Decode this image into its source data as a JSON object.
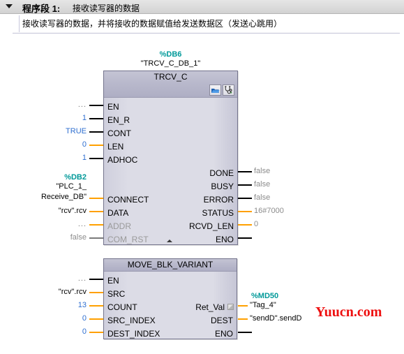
{
  "network": {
    "label": "程序段",
    "number": "1:",
    "title": "接收读写器的数据",
    "comment": "接收读写器的数据，并将接收的数据赋值给发送数据区（发送心跳用）",
    "collapse_icon": "triangle-down-icon"
  },
  "blocks": [
    {
      "id": "trcv_c",
      "db_addr": "%DB6",
      "db_name": "\"TRCV_C_DB_1\"",
      "title": "TRCV_C",
      "icons": [
        "open-block-icon",
        "stethoscope-diagnostics-icon"
      ],
      "inputs": [
        {
          "pin": "EN",
          "operand": "...",
          "op_color": "dots",
          "wire": "black",
          "pin_dim": false
        },
        {
          "pin": "EN_R",
          "operand": "1",
          "op_color": "blue",
          "wire": "black",
          "pin_dim": false
        },
        {
          "pin": "CONT",
          "operand": "TRUE",
          "op_color": "blue",
          "wire": "black",
          "pin_dim": false
        },
        {
          "pin": "LEN",
          "operand": "0",
          "op_color": "blue",
          "wire": "orange",
          "pin_dim": false
        },
        {
          "pin": "ADHOC",
          "operand": "1",
          "op_color": "blue",
          "wire": "black",
          "pin_dim": false
        },
        {
          "pin": "CONNECT",
          "operand": "",
          "op_color": "black",
          "wire": "orange",
          "pin_dim": false
        },
        {
          "pin": "DATA",
          "operand": "\"rcv\".rcv",
          "op_color": "black",
          "wire": "orange",
          "pin_dim": false
        },
        {
          "pin": "ADDR",
          "operand": "...",
          "op_color": "dots",
          "wire": "orange",
          "pin_dim": true
        },
        {
          "pin": "COM_RST",
          "operand": "false",
          "op_color": "gray",
          "wire": "black",
          "pin_dim": true
        }
      ],
      "connect_operand": {
        "addr": "%DB2",
        "line1": "\"PLC_1_",
        "line2": "Receive_DB\""
      },
      "outputs": [
        {
          "pin": "DONE",
          "operand": "false",
          "op_color": "gray",
          "wire": "black"
        },
        {
          "pin": "BUSY",
          "operand": "false",
          "op_color": "gray",
          "wire": "black"
        },
        {
          "pin": "ERROR",
          "operand": "false",
          "op_color": "gray",
          "wire": "black"
        },
        {
          "pin": "STATUS",
          "operand": "16#7000",
          "op_color": "gray",
          "wire": "orange"
        },
        {
          "pin": "RCVD_LEN",
          "operand": "0",
          "op_color": "gray",
          "wire": "orange"
        },
        {
          "pin": "ENO",
          "operand": "",
          "op_color": "gray",
          "wire": "black"
        }
      ]
    },
    {
      "id": "move_blk_variant",
      "title": "MOVE_BLK_VARIANT",
      "inputs": [
        {
          "pin": "EN",
          "operand": "...",
          "op_color": "dots",
          "wire": "black"
        },
        {
          "pin": "SRC",
          "operand": "\"rcv\".rcv",
          "op_color": "black",
          "wire": "orange"
        },
        {
          "pin": "COUNT",
          "operand": "13",
          "op_color": "blue",
          "wire": "orange"
        },
        {
          "pin": "SRC_INDEX",
          "operand": "0",
          "op_color": "blue",
          "wire": "orange"
        },
        {
          "pin": "DEST_INDEX",
          "operand": "0",
          "op_color": "blue",
          "wire": "orange"
        }
      ],
      "outputs": [
        {
          "pin": "Ret_Val",
          "addr": "%MD50",
          "operand": "\"Tag_4\"",
          "op_color": "black",
          "wire": "orange",
          "handle": true
        },
        {
          "pin": "DEST",
          "addr": "",
          "operand": "\"sendD\".sendD",
          "op_color": "black",
          "wire": "orange",
          "handle": false
        },
        {
          "pin": "ENO",
          "addr": "",
          "operand": "",
          "op_color": "gray",
          "wire": "black",
          "handle": false
        }
      ]
    }
  ],
  "watermark": {
    "text": "Yuucn.com",
    "color": "#ee1111"
  }
}
